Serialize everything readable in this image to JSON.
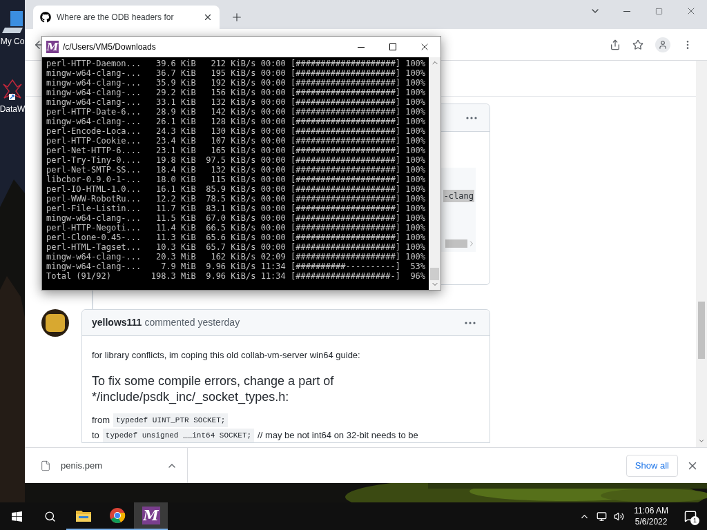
{
  "desktop": {
    "icons": [
      {
        "label": "My Co"
      },
      {
        "label": "DataW"
      }
    ]
  },
  "browser": {
    "tabs": [
      {
        "title": "Where are the ODB headers for",
        "selected": true
      }
    ],
    "page": {
      "comments": [
        {
          "code_fragment": "-clang"
        },
        {
          "author": "yellows111",
          "meta": "commented yesterday",
          "intro": "for library conflicts, im coping this old collab-vm-server win64 guide:",
          "heading": "To fix some compile errors, change a part of */include/psdk_inc/_socket_types.h:",
          "lines": [
            {
              "prefix": "from",
              "code": "typedef UINT_PTR SOCKET;"
            },
            {
              "prefix": "to",
              "code": "typedef unsigned __int64 SOCKET;",
              "suffix": "// may be not int64 on 32-bit needs to be"
            }
          ]
        }
      ]
    },
    "downloads": {
      "file": "penis.pem",
      "show_all": "Show all"
    }
  },
  "terminal": {
    "logo": "M",
    "title": "/c/Users/VM5/Downloads",
    "lines": [
      "perl-HTTP-Daemon...   39.6 KiB   212 KiB/s 00:00 [####################] 100%",
      "mingw-w64-clang-...   36.7 KiB   195 KiB/s 00:00 [####################] 100%",
      "mingw-w64-clang-...   35.9 KiB   192 KiB/s 00:00 [####################] 100%",
      "mingw-w64-clang-...   29.2 KiB   156 KiB/s 00:00 [####################] 100%",
      "mingw-w64-clang-...   33.1 KiB   132 KiB/s 00:00 [####################] 100%",
      "perl-HTTP-Date-6...   28.9 KiB   142 KiB/s 00:00 [####################] 100%",
      "mingw-w64-clang-...   26.1 KiB   128 KiB/s 00:00 [####################] 100%",
      "perl-Encode-Loca...   24.3 KiB   130 KiB/s 00:00 [####################] 100%",
      "perl-HTTP-Cookie...   23.4 KiB   107 KiB/s 00:00 [####################] 100%",
      "perl-Net-HTTP-6....   23.1 KiB   165 KiB/s 00:00 [####################] 100%",
      "perl-Try-Tiny-0....   19.8 KiB  97.5 KiB/s 00:00 [####################] 100%",
      "perl-Net-SMTP-SS...   18.4 KiB   132 KiB/s 00:00 [####################] 100%",
      "libcbor-0.9.0-1-...   18.0 KiB   115 KiB/s 00:00 [####################] 100%",
      "perl-IO-HTML-1.0...   16.1 KiB  85.9 KiB/s 00:00 [####################] 100%",
      "perl-WWW-RobotRu...   12.2 KiB  78.5 KiB/s 00:00 [####################] 100%",
      "perl-File-Listin...   11.7 KiB  83.1 KiB/s 00:00 [####################] 100%",
      "mingw-w64-clang-...   11.5 KiB  67.0 KiB/s 00:00 [####################] 100%",
      "perl-HTTP-Negoti...   11.4 KiB  66.5 KiB/s 00:00 [####################] 100%",
      "perl-Clone-0.45-...   11.3 KiB  65.6 KiB/s 00:00 [####################] 100%",
      "perl-HTML-Tagset...   10.3 KiB  65.7 KiB/s 00:00 [####################] 100%",
      "mingw-w64-clang-...   20.3 MiB   162 KiB/s 02:09 [####################] 100%",
      "mingw-w64-clang-...    7.9 MiB  9.96 KiB/s 11:34 [##########----------]  53%",
      "Total (91/92)        198.3 MiB  9.96 KiB/s 11:34 [###################-]  96%"
    ]
  },
  "taskbar": {
    "apps": [
      {
        "kind": "explorer",
        "selected": false
      },
      {
        "kind": "chrome",
        "selected": false
      },
      {
        "kind": "msys",
        "label": "M",
        "selected": true
      }
    ],
    "time": "11:06 AM",
    "date": "5/6/2022",
    "notifications": "1"
  }
}
